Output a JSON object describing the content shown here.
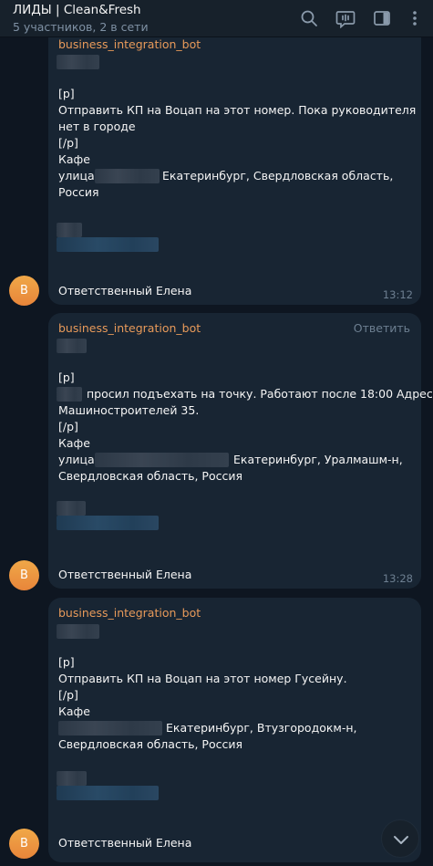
{
  "header": {
    "title": "ЛИДЫ | Clean&Fresh",
    "subtitle": "5 участников, 2 в сети",
    "icons": [
      "search-icon",
      "voice-chat-icon",
      "sidebar-toggle-icon",
      "more-options-icon"
    ]
  },
  "messages": [
    {
      "sender": "business_integration_bot",
      "tag": "[p]",
      "text_line1": "Отправить КП на Воцап на этот номер. Пока руководителя",
      "text_line2": "нет в городе",
      "link": "[/p]",
      "type": "Кафе",
      "address_prefix": "улица",
      "address_line1": "Екатеринбург, Свердловская область,",
      "address_line2": "Россия",
      "responsible": "Ответственный Елена",
      "time": "13:12",
      "avatar_letter": "B"
    },
    {
      "sender": "business_integration_bot",
      "reply_label": "Ответить",
      "tag": "[p]",
      "text_line1": "просил подъехать на точку. Работают после 18:00 Адрес",
      "text_line2": "Машиностроителей 35.",
      "link": "[/p]",
      "type": "Кафе",
      "address_prefix": "улица",
      "address_line1": "Екатеринбург, Уралмашм-н,",
      "address_line2": "Свердловская область, Россия",
      "responsible": "Ответственный Елена",
      "time": "13:28",
      "avatar_letter": "B"
    },
    {
      "sender": "business_integration_bot",
      "tag": "[p]",
      "text_line1": "Отправить КП на Воцап на этот номер Гусейну.",
      "link": "[/p]",
      "type": "Кафе",
      "address_line1": "Екатеринбург, Втузгородокм-н,",
      "address_line2": "Свердловская область, Россия",
      "responsible": "Ответственный Елена",
      "avatar_letter": "B"
    }
  ]
}
